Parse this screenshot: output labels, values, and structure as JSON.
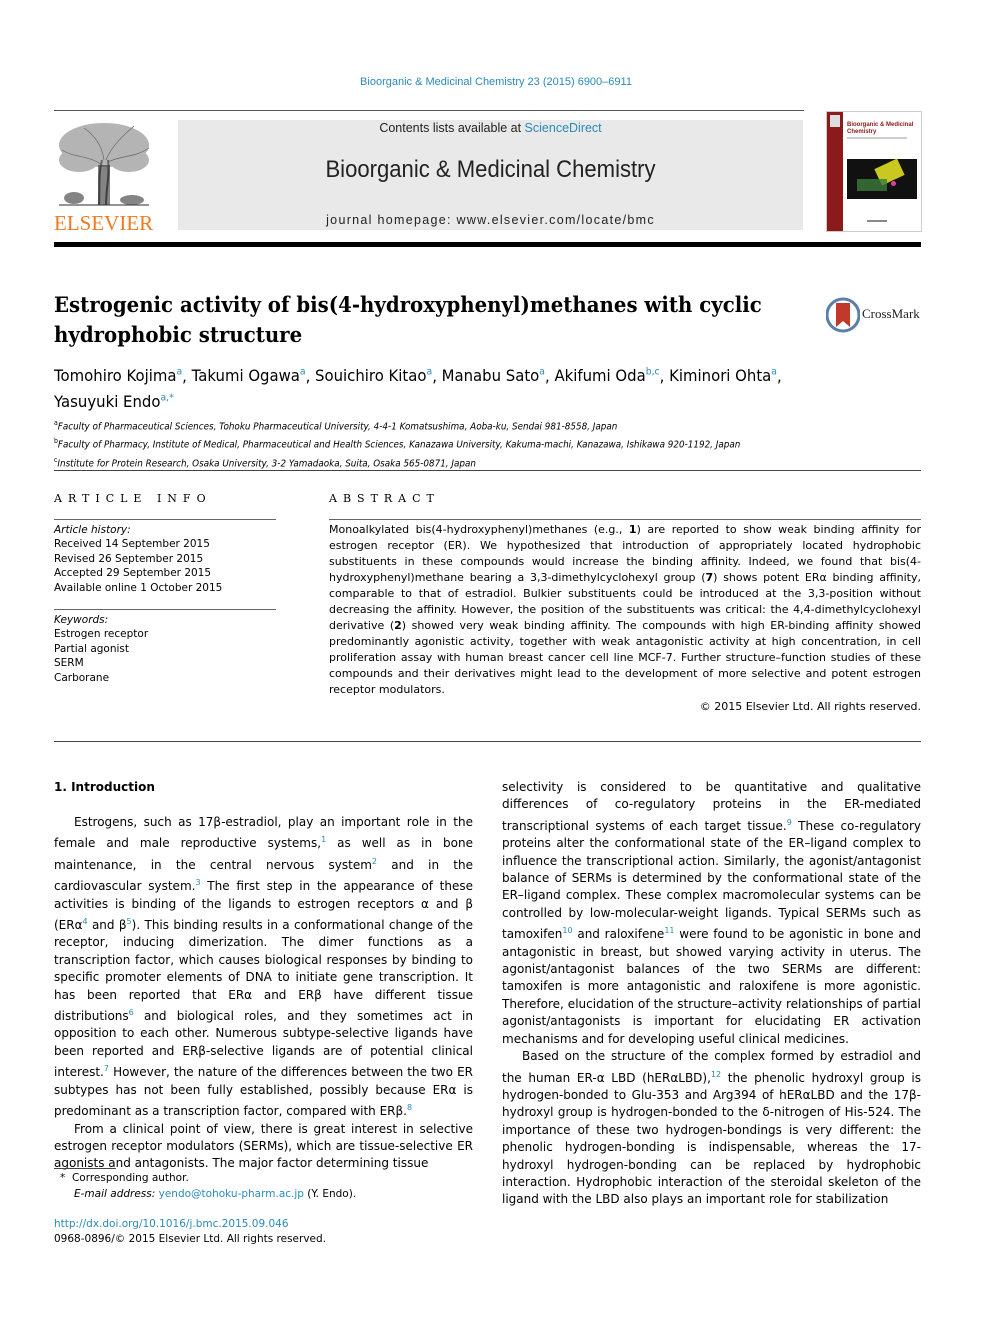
{
  "header": {
    "citation": "Bioorganic & Medicinal Chemistry 23 (2015) 6900–6911",
    "publisher_logo_text": "ELSEVIER",
    "contents_prefix": "Contents lists available at ",
    "contents_link": "ScienceDirect",
    "journal_name": "Bioorganic & Medicinal Chemistry",
    "homepage": "journal homepage: www.elsevier.com/locate/bmc",
    "cover_title": "Bioorganic & Medicinal Chemistry"
  },
  "article": {
    "title": "Estrogenic activity of bis(4-hydroxyphenyl)methanes with cyclic hydrophobic structure",
    "crossmark_label": "CrossMark",
    "authors": [
      {
        "name": "Tomohiro Kojima",
        "aff": "a"
      },
      {
        "name": "Takumi Ogawa",
        "aff": "a"
      },
      {
        "name": "Souichiro Kitao",
        "aff": "a"
      },
      {
        "name": "Manabu Sato",
        "aff": "a"
      },
      {
        "name": "Akifumi Oda",
        "aff": "b,c"
      },
      {
        "name": "Kiminori Ohta",
        "aff": "a"
      },
      {
        "name": "Yasuyuki Endo",
        "aff": "a,*"
      }
    ],
    "affiliations": [
      {
        "key": "a",
        "text": "Faculty of Pharmaceutical Sciences, Tohoku Pharmaceutical University, 4-4-1 Komatsushima, Aoba-ku, Sendai 981-8558, Japan"
      },
      {
        "key": "b",
        "text": "Faculty of Pharmacy, Institute of Medical, Pharmaceutical and Health Sciences, Kanazawa University, Kakuma-machi, Kanazawa, Ishikawa 920-1192, Japan"
      },
      {
        "key": "c",
        "text": "Institute for Protein Research, Osaka University, 3-2 Yamadaoka, Suita, Osaka 565-0871, Japan"
      }
    ]
  },
  "article_info": {
    "heading": "ARTICLE INFO",
    "history_label": "Article history:",
    "history": [
      "Received 14 September 2015",
      "Revised 26 September 2015",
      "Accepted 29 September 2015",
      "Available online 1 October 2015"
    ],
    "keywords_label": "Keywords:",
    "keywords": [
      "Estrogen receptor",
      "Partial agonist",
      "SERM",
      "Carborane"
    ]
  },
  "abstract": {
    "heading": "ABSTRACT",
    "parts": [
      "Monoalkylated bis(4-hydroxyphenyl)methanes (e.g., ",
      "1",
      ") are reported to show weak binding affinity for estrogen receptor (ER). We hypothesized that introduction of appropriately located hydrophobic substituents in these compounds would increase the binding affinity. Indeed, we found that bis(4-hydroxyphenyl)methane bearing a 3,3-dimethylcyclohexyl group (",
      "7",
      ") shows potent ERα binding affinity, comparable to that of estradiol. Bulkier substituents could be introduced at the 3,3-position without decreasing the affinity. However, the position of the substituents was critical: the 4,4-dimethylcyclohexyl derivative (",
      "2",
      ") showed very weak binding affinity. The compounds with high ER-binding affinity showed predominantly agonistic activity, together with weak antagonistic activity at high concentration, in cell proliferation assay with human breast cancer cell line MCF-7. Further structure–function studies of these compounds and their derivatives might lead to the development of more selective and potent estrogen receptor modulators."
    ],
    "copyright": "© 2015 Elsevier Ltd. All rights reserved."
  },
  "body": {
    "section_heading": "1. Introduction",
    "left_col": [
      {
        "indent": true,
        "segments": [
          {
            "t": "Estrogens, such as 17β-estradiol, play an important role in the female and male reproductive systems,"
          },
          {
            "ref": "1"
          },
          {
            "t": " as well as in bone maintenance, in the central nervous system"
          },
          {
            "ref": "2"
          },
          {
            "t": " and in the cardiovascular system."
          },
          {
            "ref": "3"
          },
          {
            "t": " The first step in the appearance of these activities is binding of the ligands to estrogen receptors α and β (ERα"
          },
          {
            "ref": "4"
          },
          {
            "t": " and β"
          },
          {
            "ref": "5"
          },
          {
            "t": "). This binding results in a conformational change of the receptor, inducing dimerization. The dimer functions as a transcription factor, which causes biological responses by binding to specific promoter elements of DNA to initiate gene transcription. It has been reported that ERα and ERβ have different tissue distributions"
          },
          {
            "ref": "6"
          },
          {
            "t": " and biological roles, and they sometimes act in opposition to each other. Numerous subtype-selective ligands have been reported and ERβ-selective ligands are of potential clinical interest."
          },
          {
            "ref": "7"
          },
          {
            "t": " However, the nature of the differences between the two ER subtypes has not been fully established, possibly because ERα is predominant as a transcription factor, compared with ERβ."
          },
          {
            "ref": "8"
          }
        ]
      },
      {
        "indent": true,
        "segments": [
          {
            "t": "From a clinical point of view, there is great interest in selective estrogen receptor modulators (SERMs), which are tissue-selective ER agonists and antagonists. The major factor determining tissue"
          }
        ]
      }
    ],
    "right_col": [
      {
        "indent": false,
        "segments": [
          {
            "t": "selectivity is considered to be quantitative and qualitative differences of co-regulatory proteins in the ER-mediated transcriptional systems of each target tissue."
          },
          {
            "ref": "9"
          },
          {
            "t": " These co-regulatory proteins alter the conformational state of the ER–ligand complex to influence the transcriptional action. Similarly, the agonist/antagonist balance of SERMs is determined by the conformational state of the ER–ligand complex. These complex macromolecular systems can be controlled by low-molecular-weight ligands. Typical SERMs such as tamoxifen"
          },
          {
            "ref": "10"
          },
          {
            "t": " and raloxifene"
          },
          {
            "ref": "11"
          },
          {
            "t": " were found to be agonistic in bone and antagonistic in breast, but showed varying activity in uterus. The agonist/antagonist balances of the two SERMs are different: tamoxifen is more antagonistic and raloxifene is more agonistic. Therefore, elucidation of the structure–activity relationships of partial agonist/antagonists is important for elucidating ER activation mechanisms and for developing useful clinical medicines."
          }
        ]
      },
      {
        "indent": true,
        "segments": [
          {
            "t": "Based on the structure of the complex formed by estradiol and the human ER-α LBD (hERαLBD),"
          },
          {
            "ref": "12"
          },
          {
            "t": " the phenolic hydroxyl group is hydrogen-bonded to Glu-353 and Arg394 of hERαLBD and the 17β-hydroxyl group is hydrogen-bonded to the δ-nitrogen of His-524. The importance of these two hydrogen-bondings is very different: the phenolic hydrogen-bonding is indispensable, whereas the 17-hydroxyl hydrogen-bonding can be replaced by hydrophobic interaction. Hydrophobic interaction of the steroidal skeleton of the ligand with the LBD also plays an important role for stabilization"
          }
        ]
      }
    ]
  },
  "footnotes": {
    "corresponding_mark": "*",
    "corresponding": "Corresponding author.",
    "email_label": "E-mail address:",
    "email": "yendo@tohoku-pharm.ac.jp",
    "email_suffix": " (Y. Endo).",
    "doi": "http://dx.doi.org/10.1016/j.bmc.2015.09.046",
    "issn_line": "0968-0896/© 2015 Elsevier Ltd. All rights reserved."
  },
  "colors": {
    "link": "#2a8ab8",
    "elsevier_orange": "#f07a20",
    "masthead_bg": "#e9e9e9",
    "cover_red": "#8b1a1a"
  }
}
